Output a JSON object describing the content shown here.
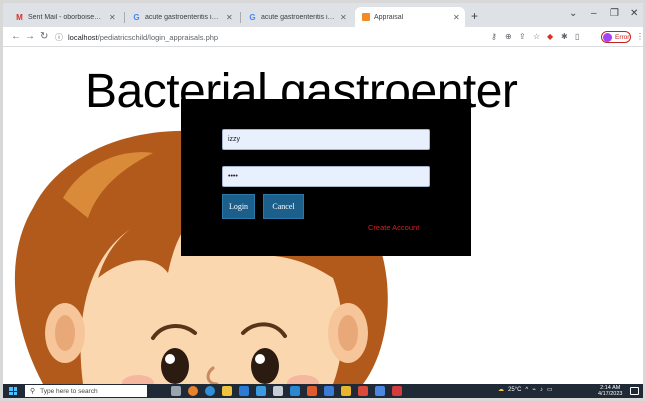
{
  "browser": {
    "tabs": [
      {
        "title": "Sent Mail - oborboise88@gmail",
        "favicon": "gmail-icon",
        "active": false
      },
      {
        "title": "acute gastroenteritis images - G",
        "favicon": "google-icon",
        "active": false
      },
      {
        "title": "acute gastroenteritis images - G",
        "favicon": "google-icon",
        "active": false
      },
      {
        "title": "Appraisal",
        "favicon": "page-icon",
        "active": true
      }
    ],
    "url_host": "localhost",
    "url_path": "/pediatricschild/login_appraisals.php",
    "profile_label": "Error"
  },
  "page": {
    "heading": "Bacterial gastroenter"
  },
  "login": {
    "username_value": "izzy",
    "password_value": "••••",
    "login_label": "Login",
    "cancel_label": "Cancel",
    "create_account_label": "Create Account"
  },
  "taskbar": {
    "search_placeholder": "Type here to search",
    "temperature": "25°C",
    "time": "2:14 AM",
    "date": "4/17/2023"
  },
  "colors": {
    "modal_bg": "#000000",
    "button_bg": "#1c5f8a",
    "link_red": "#d91f1f",
    "field_bg": "#e8f0fe"
  }
}
